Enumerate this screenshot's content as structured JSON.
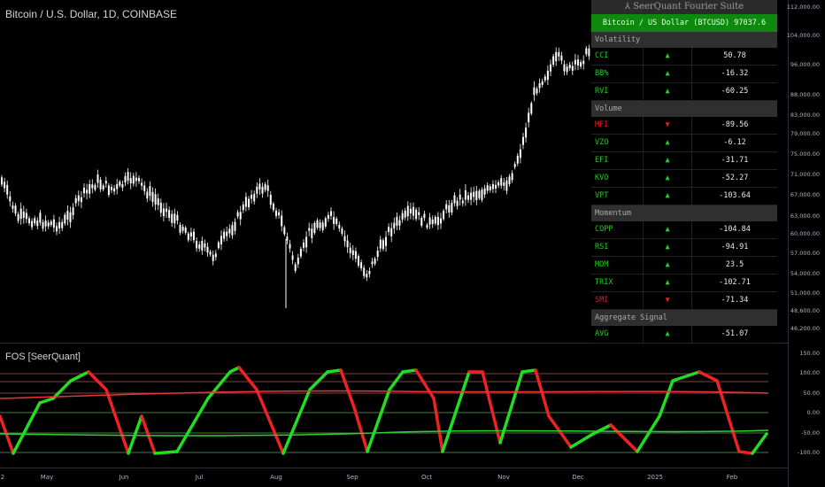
{
  "chart_title": "Bitcoin / U.S. Dollar, 1D, COINBASE",
  "indicator_title": "FOS [SeerQuant]",
  "price_axis": [
    "112,000.00",
    "104,000.00",
    "96,000.00",
    "88,000.00",
    "83,000.00",
    "79,000.00",
    "75,000.00",
    "71,000.00",
    "67,000.00",
    "63,000.00",
    "60,000.00",
    "57,000.00",
    "54,000.00",
    "51,000.00",
    "48,600.00",
    "46,200.00"
  ],
  "osc_axis": [
    "150.00",
    "100.00",
    "50.00",
    "0.00",
    "-50.00",
    "-100.00"
  ],
  "x_axis": [
    "2",
    "May",
    "Jun",
    "Jul",
    "Aug",
    "Sep",
    "Oct",
    "Nov",
    "Dec",
    "2025",
    "Feb"
  ],
  "colors": {
    "bull": "#22dd22",
    "bear": "#ee2222",
    "table_green": "#0d8a0d",
    "background": "#000000"
  },
  "panel": {
    "header": "⅄ SeerQuant Fourier Suite",
    "asset": "Bitcoin / US Dollar (BTCUSD)  97037.6",
    "sections": [
      {
        "title": "Volatility",
        "rows": [
          {
            "name": "CCI",
            "dir": "up",
            "arrow": "▲",
            "value": "50.78"
          },
          {
            "name": "BB%",
            "dir": "up",
            "arrow": "▲",
            "value": "-16.32"
          },
          {
            "name": "RVI",
            "dir": "up",
            "arrow": "▲",
            "value": "-60.25"
          }
        ]
      },
      {
        "title": "Volume",
        "rows": [
          {
            "name": "MFI",
            "dir": "dn",
            "arrow": "▼",
            "value": "-89.56"
          },
          {
            "name": "VZO",
            "dir": "up",
            "arrow": "▲",
            "value": "-6.12"
          },
          {
            "name": "EFI",
            "dir": "up",
            "arrow": "▲",
            "value": "-31.71"
          },
          {
            "name": "KVO",
            "dir": "up",
            "arrow": "▲",
            "value": "-52.27"
          },
          {
            "name": "VPT",
            "dir": "up",
            "arrow": "▲",
            "value": "-103.64"
          }
        ]
      },
      {
        "title": "Momentum",
        "rows": [
          {
            "name": "COPP",
            "dir": "up",
            "arrow": "▲",
            "value": "-104.84"
          },
          {
            "name": "RSI",
            "dir": "up",
            "arrow": "▲",
            "value": "-94.91"
          },
          {
            "name": "MOM",
            "dir": "up",
            "arrow": "▲",
            "value": "23.5"
          },
          {
            "name": "TRIX",
            "dir": "up",
            "arrow": "▲",
            "value": "-102.71"
          },
          {
            "name": "SMI",
            "dir": "dn",
            "arrow": "▼",
            "value": "-71.34"
          }
        ]
      },
      {
        "title": "Aggregate Signal",
        "rows": [
          {
            "name": "AVG",
            "dir": "up",
            "arrow": "▲",
            "value": "-51.07"
          }
        ]
      }
    ]
  }
}
